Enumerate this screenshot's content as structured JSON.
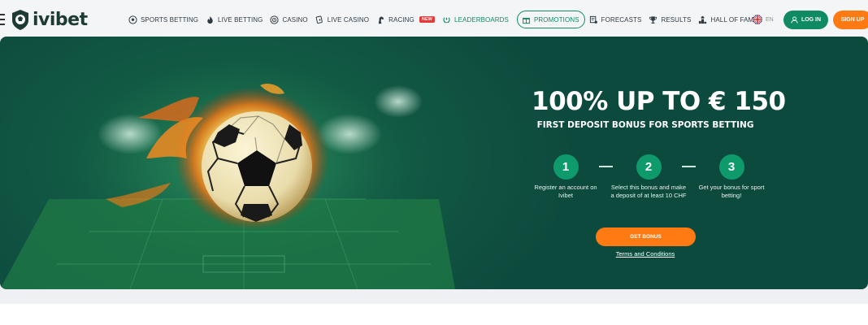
{
  "header": {
    "logo_text": "ivibet",
    "nav": [
      {
        "label": "SPORTS BETTING",
        "icon": "soccer-ball-icon"
      },
      {
        "label": "LIVE BETTING",
        "icon": "flame-icon"
      },
      {
        "label": "CASINO",
        "icon": "roulette-icon"
      },
      {
        "label": "LIVE CASINO",
        "icon": "card-icon"
      },
      {
        "label": "RACING",
        "icon": "horse-icon",
        "badge": "NEW"
      },
      {
        "label": "LEADERBOARDS",
        "icon": "laurel-icon"
      },
      {
        "label": "PROMOTIONS",
        "icon": "gift-icon"
      },
      {
        "label": "FORECASTS",
        "icon": "forecast-icon"
      },
      {
        "label": "RESULTS",
        "icon": "trophy-icon"
      },
      {
        "label": "HALL OF FAME",
        "icon": "podium-icon"
      }
    ],
    "lang": "EN",
    "login_label": "LOG IN",
    "signup_label": "SIGN UP"
  },
  "hero": {
    "title": "100% UP TO € 150",
    "subtitle": "FIRST DEPOSIT BONUS FOR SPORTS BETTING",
    "steps": [
      {
        "num": "1",
        "text": "Register an account on Ivibet"
      },
      {
        "num": "2",
        "text": "Select this bonus and make a deposit of at least 10 CHF"
      },
      {
        "num": "3",
        "text": "Get your bonus for sport betting!"
      }
    ],
    "cta_label": "GET BONUS",
    "terms_label": "Terms and Conditions"
  },
  "colors": {
    "brand_green": "#0f8a63",
    "accent_orange": "#ff7a12",
    "hero_bg": "#0d4a3e"
  }
}
